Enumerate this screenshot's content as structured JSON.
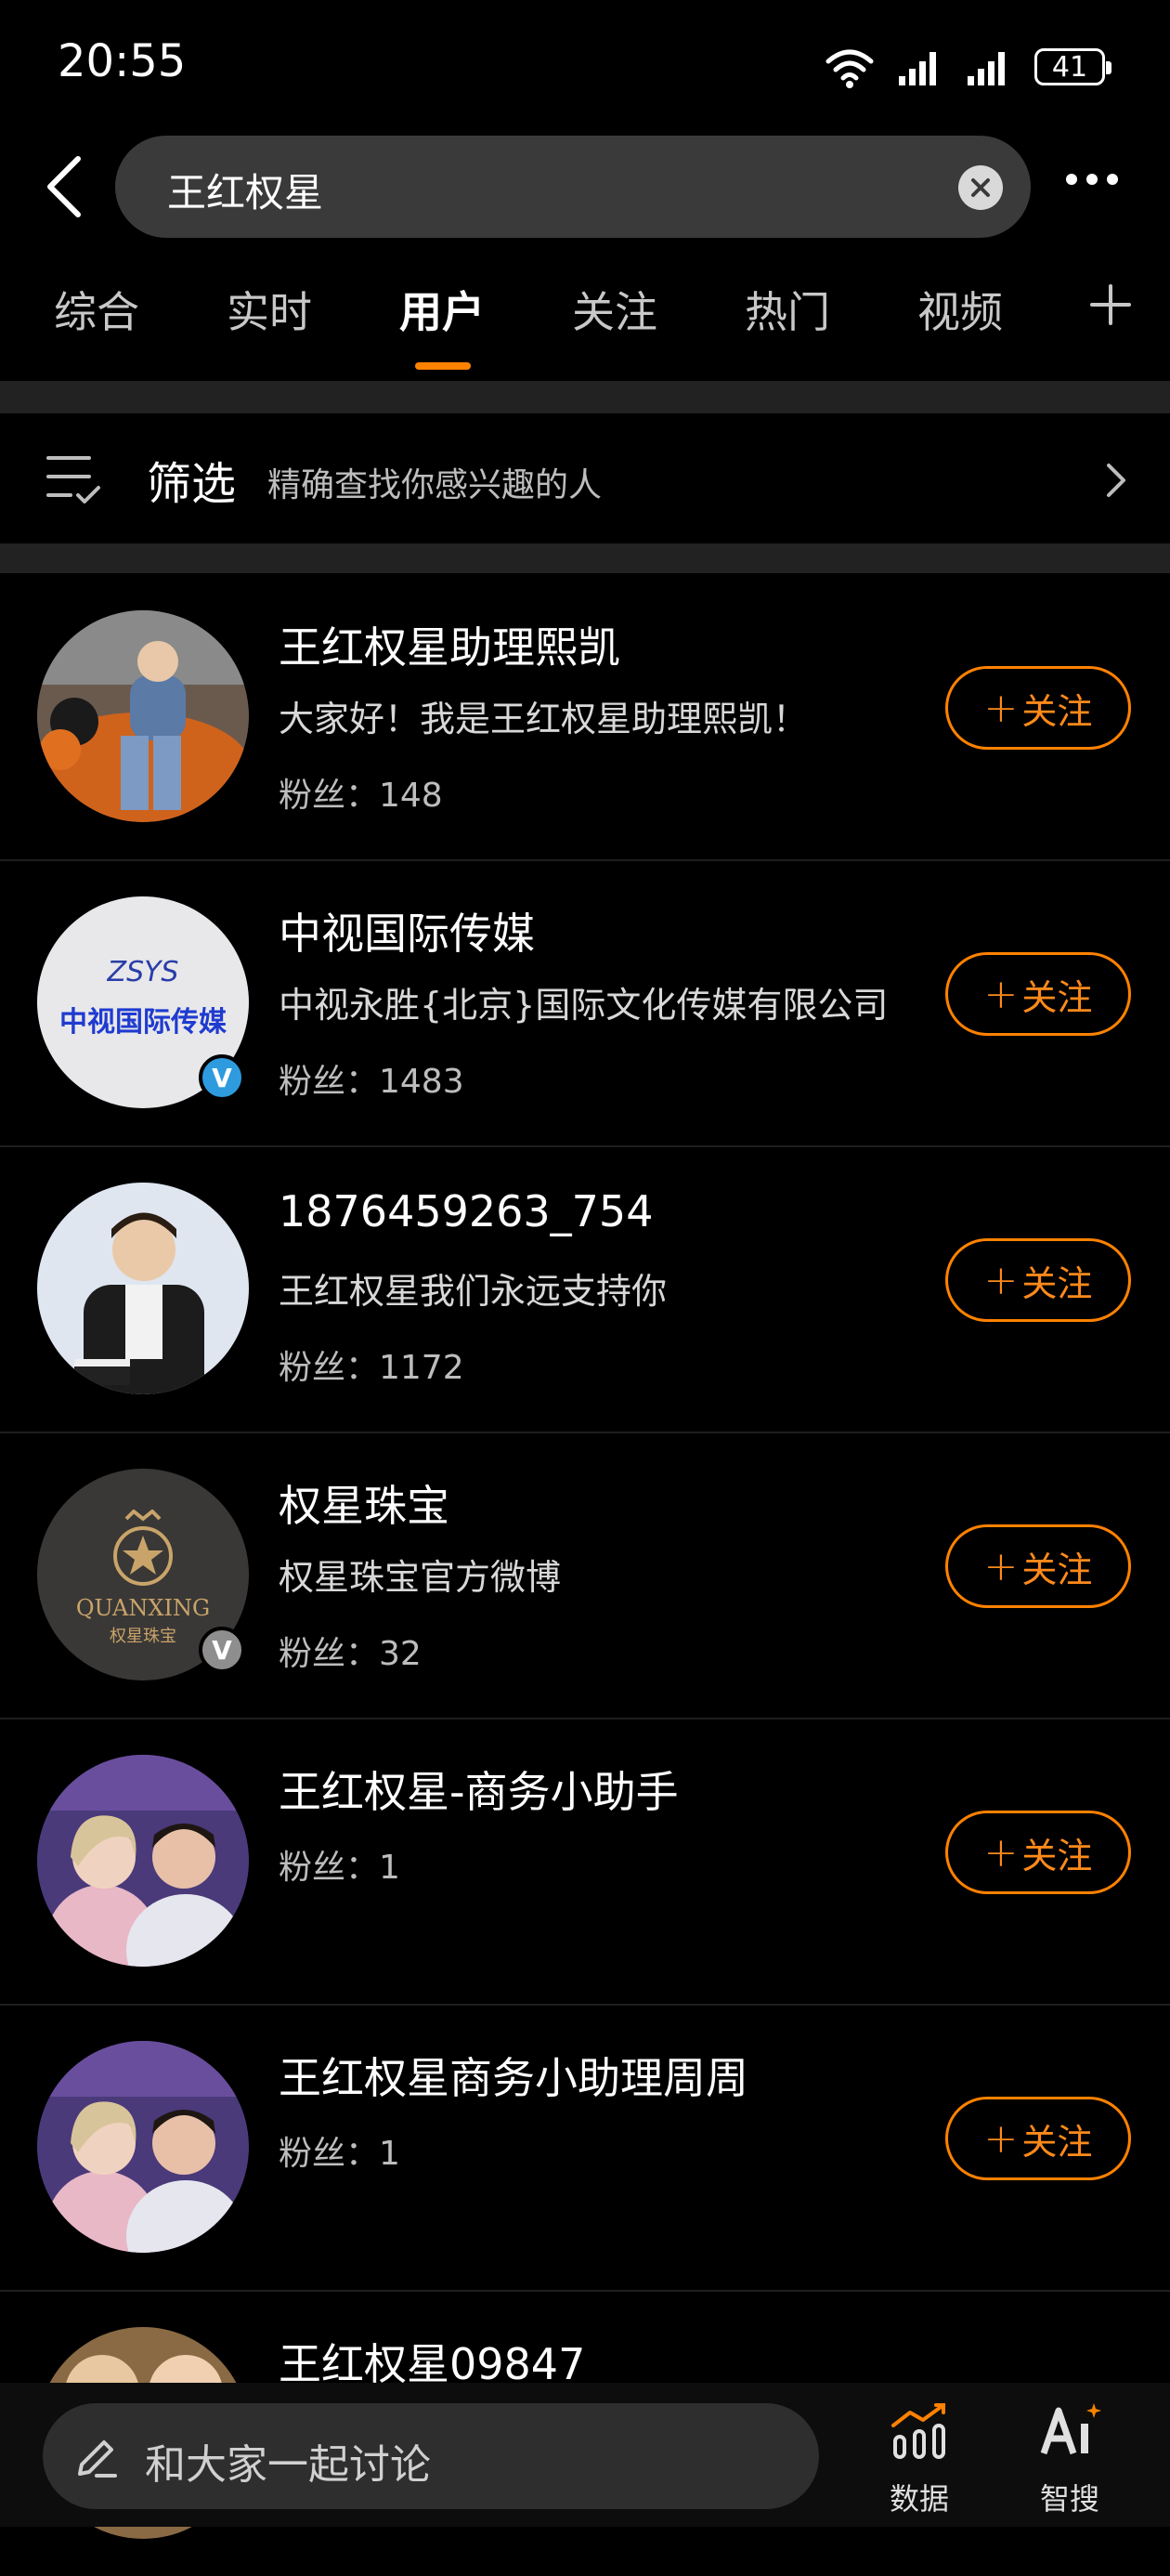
{
  "status": {
    "time": "20:55",
    "battery": "41"
  },
  "search": {
    "query": "王红权星"
  },
  "tabs": [
    {
      "label": "综合"
    },
    {
      "label": "实时"
    },
    {
      "label": "用户"
    },
    {
      "label": "关注"
    },
    {
      "label": "热门"
    },
    {
      "label": "视频"
    }
  ],
  "filter": {
    "label": "筛选",
    "description": "精确查找你感兴趣的人"
  },
  "follow_label": "关注",
  "users": [
    {
      "name": "王红权星助理熙凯",
      "desc": "大家好！我是王红权星助理熙凯！",
      "fans": "粉丝：148",
      "verified": ""
    },
    {
      "name": "中视国际传媒",
      "desc": "中视永胜{北京}国际文化传媒有限公司",
      "fans": "粉丝：1483",
      "verified": "blue",
      "logo_text": "中视国际传媒",
      "logo_script": "ZSYS"
    },
    {
      "name": "1876459263_754",
      "desc": "王红权星我们永远支持你",
      "fans": "粉丝：1172",
      "verified": ""
    },
    {
      "name": "权星珠宝",
      "desc": "权星珠宝官方微博",
      "fans": "粉丝：32",
      "verified": "gray",
      "logo_text": "QUANXING",
      "logo_sub": "权星珠宝"
    },
    {
      "name": "王红权星-商务小助手",
      "desc": "",
      "fans": "粉丝：1",
      "verified": ""
    },
    {
      "name": "王红权星商务小助理周周",
      "desc": "",
      "fans": "粉丝：1",
      "verified": ""
    },
    {
      "name": "王红权星09847",
      "desc": "",
      "fans": "",
      "verified": ""
    }
  ],
  "bottom": {
    "comment_placeholder": "和大家一起讨论",
    "data_label": "数据",
    "ai_label": "智搜"
  },
  "colors": {
    "accent": "#ff8200",
    "verify_blue": "#2e9bdf",
    "verify_gray": "#8e8e8e"
  }
}
